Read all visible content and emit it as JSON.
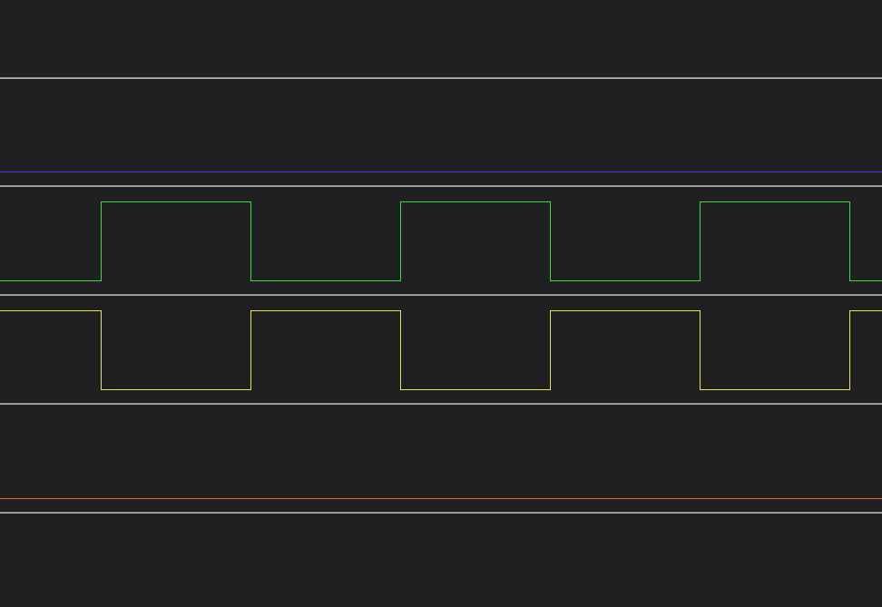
{
  "colors": {
    "background": "#202023",
    "separator": "#8a8a8c",
    "separator_highlight": "#b4b4b6"
  },
  "channels": [
    {
      "name": "",
      "color": "#3a3ae8",
      "signal": "constant",
      "level": 0
    },
    {
      "name": "",
      "color": "#3ddc3d",
      "signal": "clock",
      "initial_level": 0,
      "transitions_per_view": 11
    },
    {
      "name": "",
      "color": "#e6e645",
      "signal": "clock",
      "initial_level": 1,
      "transitions_per_view": 11
    },
    {
      "name": "",
      "color": "#e4653a",
      "signal": "constant",
      "level": 0
    }
  ]
}
